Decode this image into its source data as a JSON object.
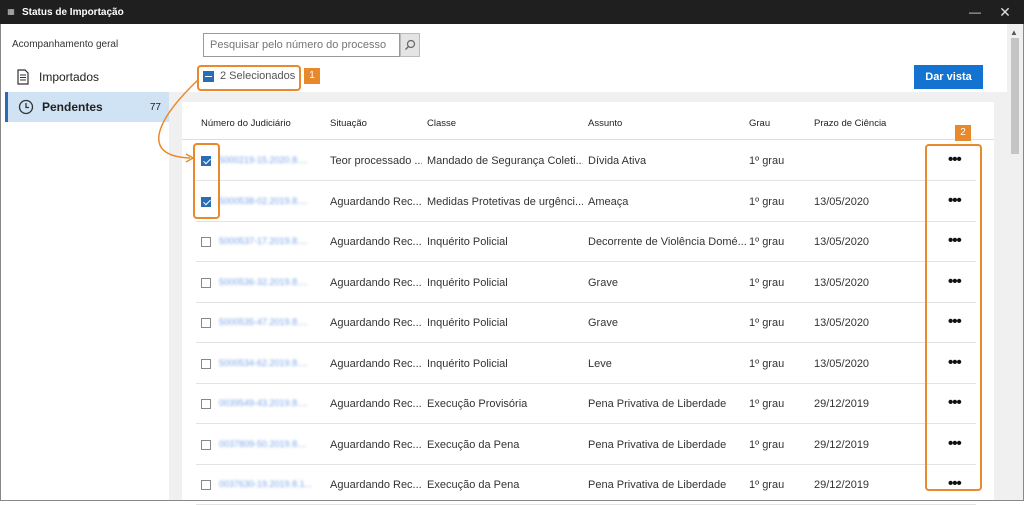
{
  "window": {
    "title": "Status de Importação"
  },
  "sidebar": {
    "heading": "Acompanhamento geral",
    "items": [
      {
        "label": "Importados",
        "icon": "document-icon",
        "count": ""
      },
      {
        "label": "Pendentes",
        "icon": "clock-icon",
        "count": "77"
      }
    ]
  },
  "toolbar": {
    "search_placeholder": "Pesquisar pelo número do processo",
    "selected_label": "2 Selecionados",
    "dar_vista_label": "Dar vista"
  },
  "table": {
    "columns": [
      "Número do Judiciário",
      "Situação",
      "Classe",
      "Assunto",
      "Grau",
      "Prazo de Ciência"
    ],
    "rows": [
      {
        "checked": true,
        "numero": "5000219-15.2020.8....",
        "situacao": "Teor processado ...",
        "classe": "Mandado de Segurança Coleti...",
        "assunto": "Dívida Ativa",
        "grau": "1º grau",
        "prazo": ""
      },
      {
        "checked": true,
        "numero": "5000538-02.2019.8....",
        "situacao": "Aguardando Rec...",
        "classe": "Medidas Protetivas de urgênci...",
        "assunto": "Ameaça",
        "grau": "1º grau",
        "prazo": "13/05/2020"
      },
      {
        "checked": false,
        "numero": "5000537-17.2019.8....",
        "situacao": "Aguardando Rec...",
        "classe": "Inquérito Policial",
        "assunto": "Decorrente de Violência Domé...",
        "grau": "1º grau",
        "prazo": "13/05/2020"
      },
      {
        "checked": false,
        "numero": "5000536-32.2019.8....",
        "situacao": "Aguardando Rec...",
        "classe": "Inquérito Policial",
        "assunto": "Grave",
        "grau": "1º grau",
        "prazo": "13/05/2020"
      },
      {
        "checked": false,
        "numero": "5000535-47.2019.8....",
        "situacao": "Aguardando Rec...",
        "classe": "Inquérito Policial",
        "assunto": "Grave",
        "grau": "1º grau",
        "prazo": "13/05/2020"
      },
      {
        "checked": false,
        "numero": "5000534-62.2019.8....",
        "situacao": "Aguardando Rec...",
        "classe": "Inquérito Policial",
        "assunto": "Leve",
        "grau": "1º grau",
        "prazo": "13/05/2020"
      },
      {
        "checked": false,
        "numero": "0039549-43.2019.8....",
        "situacao": "Aguardando Rec...",
        "classe": "Execução Provisória",
        "assunto": "Pena Privativa de Liberdade",
        "grau": "1º grau",
        "prazo": "29/12/2019"
      },
      {
        "checked": false,
        "numero": "0037809-50.2019.8....",
        "situacao": "Aguardando Rec...",
        "classe": "Execução da Pena",
        "assunto": "Pena Privativa de Liberdade",
        "grau": "1º grau",
        "prazo": "29/12/2019"
      },
      {
        "checked": false,
        "numero": "0037630-19.2019.8.1...",
        "situacao": "Aguardando Rec...",
        "classe": "Execução da Pena",
        "assunto": "Pena Privativa de Liberdade",
        "grau": "1º grau",
        "prazo": "29/12/2019"
      }
    ]
  },
  "annotations": {
    "marker1": "1",
    "marker2": "2"
  },
  "colors": {
    "accent": "#1473d1",
    "annotation": "#e8892b",
    "sidebar_active": "#cfe3f5"
  }
}
